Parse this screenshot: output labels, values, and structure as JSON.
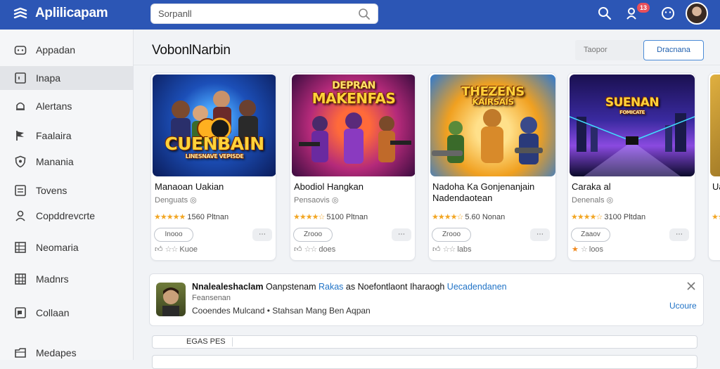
{
  "app": {
    "title": "Aplilicapam"
  },
  "search": {
    "placeholder": "Sorpanll"
  },
  "header_badge": "13",
  "sidebar": {
    "items": [
      {
        "label": "Appadan",
        "icon": "gamepad-icon"
      },
      {
        "label": "Inapa",
        "icon": "square-icon",
        "active": true
      },
      {
        "label": "Alertans",
        "icon": "bell-icon"
      },
      {
        "label": "Faalaira",
        "icon": "flag-icon"
      },
      {
        "label": "Manania",
        "icon": "shield-icon"
      },
      {
        "label": "Tovens",
        "icon": "list-icon"
      },
      {
        "label": "Copddrevcrte",
        "icon": "user-icon"
      },
      {
        "label": "Neomaria",
        "icon": "grid-icon"
      },
      {
        "label": "Madnrs",
        "icon": "table-icon"
      },
      {
        "label": "Collaan",
        "icon": "chat-icon"
      },
      {
        "label": "Medapes",
        "icon": "folder-icon"
      }
    ]
  },
  "main": {
    "title": "VobonlNarbin",
    "filter_placeholder": "Taopor",
    "primary_button": "Dracnana"
  },
  "cards": [
    {
      "art_title": "CUENBAIN",
      "art_sub": "LINESNAVE VEPISDE",
      "name": "Manaoan Uakian",
      "dev": "Denguats",
      "rating_text": "1560 Pltnan",
      "stars": "★★★★★",
      "pill": "Inooo",
      "mini": "⋯",
      "foot": "Kuoe"
    },
    {
      "art_title": "MAKENFAS",
      "art_sub": "DEPRAN",
      "name": "Abodiol Hangkan",
      "dev": "Pensaovis",
      "rating_text": "5100 Pltnan",
      "stars": "★★★★☆",
      "pill": "Zrooo",
      "mini": "⋯",
      "foot": "does"
    },
    {
      "art_title": "THEZENS",
      "art_sub": "KAIRSAIS",
      "name": "Nadoha Ka Gonjenanjain Nadendaotean",
      "dev": "",
      "rating_text": "5.60 Nonan",
      "stars": "★★★★☆",
      "pill": "Zrooo",
      "mini": "⋯",
      "foot": "labs"
    },
    {
      "art_title": "SUENAN",
      "art_sub": "FOMICATE",
      "name": "Caraka al",
      "dev": "Denenals",
      "rating_text": "3100 Pltdan",
      "stars": "★★★★☆",
      "pill": "Zaaov",
      "mini": "⋯",
      "foot": "loos"
    },
    {
      "art_title": "",
      "art_sub": "",
      "name": "Ua",
      "dev": "",
      "rating_text": "",
      "stars": "★★",
      "pill": "",
      "mini": "",
      "foot": ""
    }
  ],
  "notification": {
    "line1_a": "Nnalealeshaclam",
    "line1_b": "Oanpstenam",
    "line1_link": "Rakas",
    "line1_c": "as Noefontlaont Iharaogh",
    "line1_link2": "Uecadendanen",
    "line2": "Feansenan",
    "line3": "Cooendes Mulcand • Stahsan Mang Ben Aqpan",
    "action": "Ucoure"
  },
  "bottom": {
    "label": "EGAS PES"
  },
  "colors": {
    "topbar": "#2c56b5",
    "accent": "#1f72c6",
    "star": "#f2a623"
  }
}
